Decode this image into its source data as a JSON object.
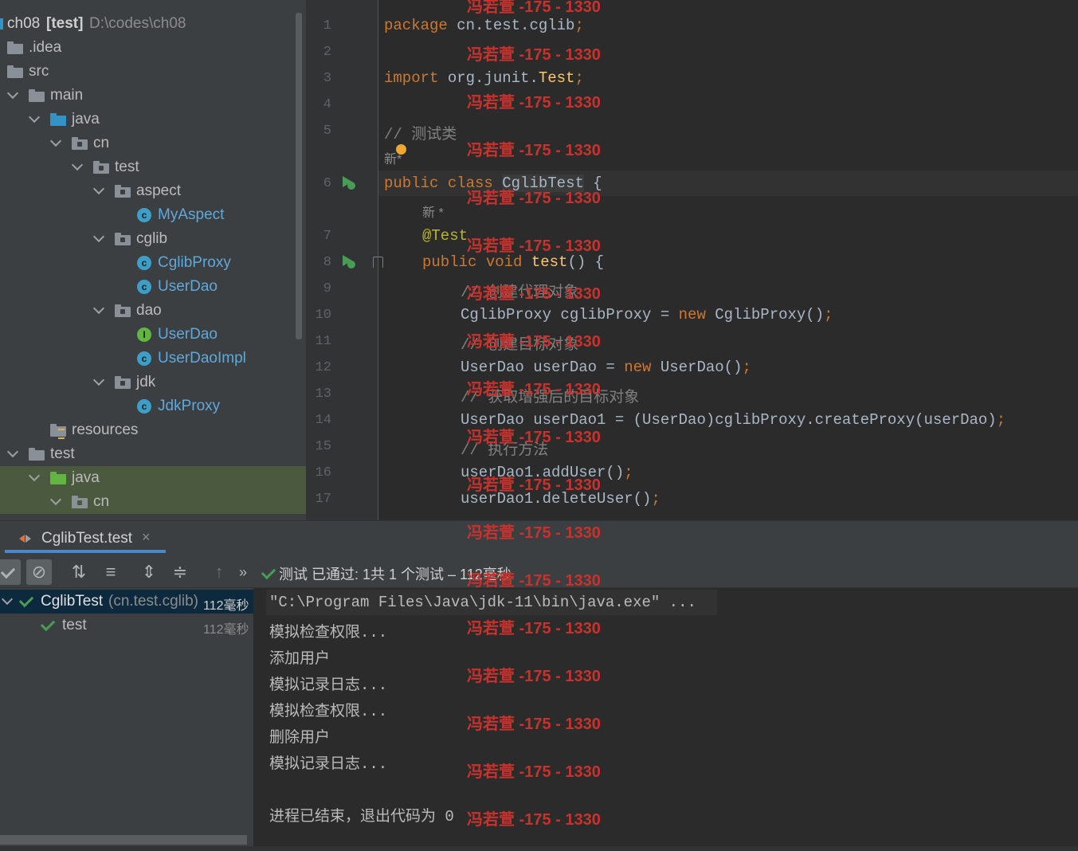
{
  "project": {
    "root": {
      "name": "ch08",
      "module": "[test]",
      "path": "D:\\codes\\ch08"
    },
    "items": [
      {
        "label": "ch08"
      },
      {
        "label": ".idea"
      },
      {
        "label": "src"
      },
      {
        "label": "main"
      },
      {
        "label": "java"
      },
      {
        "label": "cn"
      },
      {
        "label": "test"
      },
      {
        "label": "aspect"
      },
      {
        "label": "MyAspect"
      },
      {
        "label": "cglib"
      },
      {
        "label": "CglibProxy"
      },
      {
        "label": "UserDao"
      },
      {
        "label": "dao"
      },
      {
        "label": "UserDao"
      },
      {
        "label": "UserDaoImpl"
      },
      {
        "label": "jdk"
      },
      {
        "label": "JdkProxy"
      },
      {
        "label": "resources"
      },
      {
        "label": "test"
      },
      {
        "label": "java"
      },
      {
        "label": "cn"
      }
    ]
  },
  "editor": {
    "line_numbers": [
      "1",
      "2",
      "3",
      "4",
      "5",
      "6",
      "7",
      "8",
      "9",
      "10",
      "11",
      "12",
      "13",
      "14",
      "15",
      "16",
      "17"
    ],
    "code": {
      "l1_kw": "package",
      "l1_rest": " cn.test.cglib",
      "semi": ";",
      "l3_kw": "import",
      "l3_rest": " org.junit.",
      "l3_cls": "Test",
      "l5": "// 测试类",
      "hint1": "新*",
      "l6_kw1": "public",
      "l6_kw2": "class",
      "l6_cls": "CglibTest",
      "l6_brace": " {",
      "hint2": "新 *",
      "l7": "@Test",
      "l8_kw1": "public",
      "l8_kw2": "void",
      "l8_fn": "test",
      "l8_rest": "() {",
      "l9": "// 创建代理对象",
      "l10_a": "CglibProxy cglibProxy = ",
      "l10_new": "new",
      "l10_b": " CglibProxy()",
      "l11": "// 创建目标对象",
      "l12_a": "UserDao userDao = ",
      "l12_new": "new",
      "l12_b": " UserDao()",
      "l13": "// 获取增强后的目标对象",
      "l14": "UserDao userDao1 = (UserDao)cglibProxy.createProxy(userDao)",
      "l15": "// 执行方法",
      "l16": "userDao1.addUser()",
      "l17": "userDao1.deleteUser()"
    }
  },
  "watermark": "冯若萱 -175 - 1330",
  "run": {
    "tab_label": "CglibTest.test",
    "status": "测试 已通过: 1共 1 个测试 – 112毫秒",
    "results": [
      {
        "name": "CglibTest",
        "pkg": "(cn.test.cglib)",
        "time": "112毫秒"
      },
      {
        "name": "test",
        "time": "112毫秒"
      }
    ],
    "console": [
      "\"C:\\Program Files\\Java\\jdk-11\\bin\\java.exe\" ...",
      "模拟检查权限...",
      "添加用户",
      "模拟记录日志...",
      "模拟检查权限...",
      "删除用户",
      "模拟记录日志...",
      "进程已结束，退出代码为 0"
    ]
  }
}
